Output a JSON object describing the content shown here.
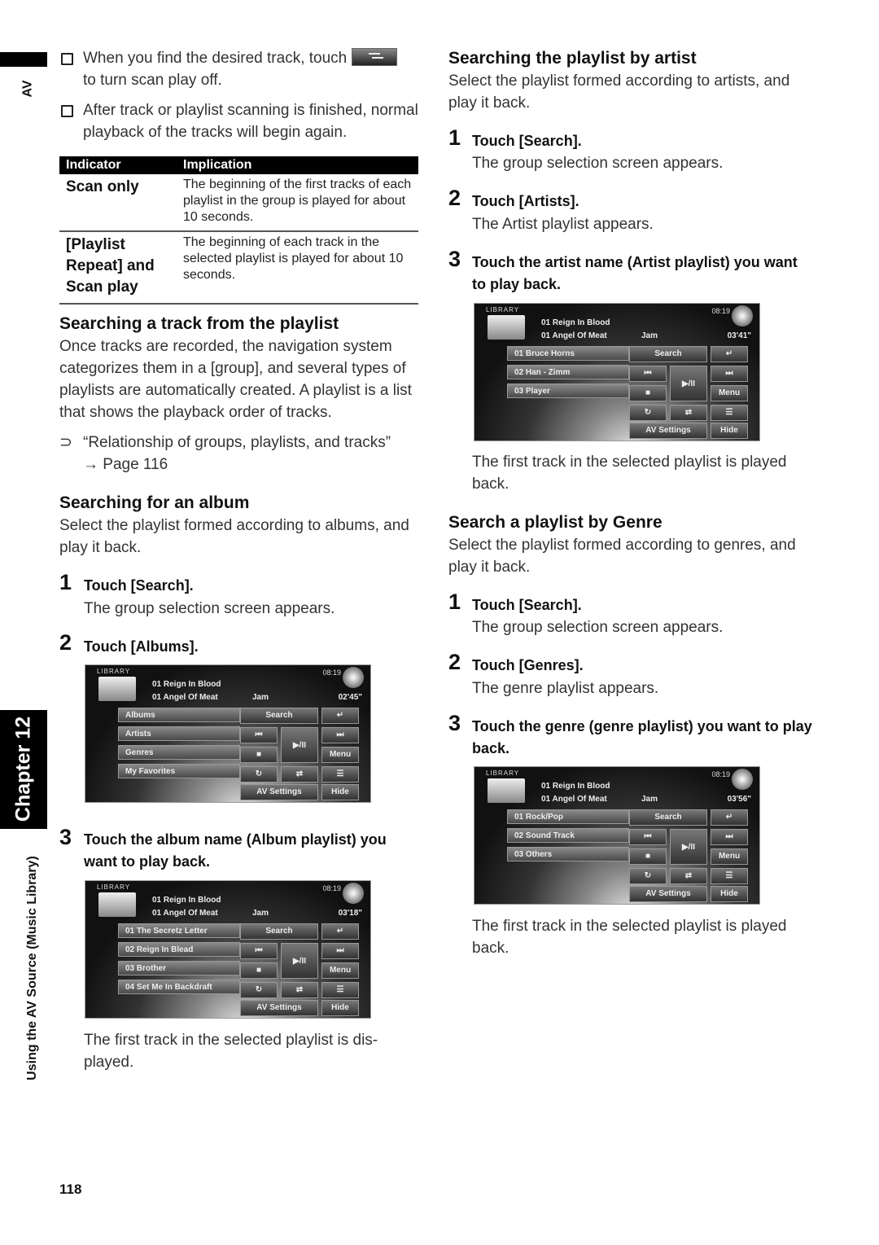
{
  "side": {
    "section_tab": "AV",
    "chapter_label": "Chapter 12",
    "chapter_title": "Using the AV Source (Music Library)"
  },
  "page_number": "118",
  "left": {
    "notes": [
      {
        "before": "When you find the desired track, touch",
        "icon": "scan-button-icon",
        "after": "to turn scan play off."
      },
      {
        "text": "After track or playlist scanning is finished, normal playback of the tracks will begin again."
      }
    ],
    "table": {
      "headers": [
        "Indicator",
        "Implication"
      ],
      "rows": [
        {
          "indicator": "Scan only",
          "implication": "The beginning of the first tracks of each playlist in the group is played for about 10 seconds."
        },
        {
          "indicator": "[Playlist Repeat] and Scan play",
          "implication": "The beginning of each track in the selected playlist is played for about 10 seconds."
        }
      ]
    },
    "section_track": {
      "heading": "Searching a track from the playlist",
      "body": "Once tracks are recorded, the navigation system categorizes them in a [group], and several types of playlists are automatically created. A playlist is a list that shows the playback order of tracks.",
      "ref_text": "“Relationship of groups, playlists, and tracks”",
      "ref_page": "→ Page 116"
    },
    "section_album": {
      "heading": "Searching for an album",
      "body": "Select the playlist formed according to albums, and play it back.",
      "steps": [
        {
          "num": "1",
          "title": "Touch [Search].",
          "desc": "The group selection screen appears."
        },
        {
          "num": "2",
          "title": "Touch [Albums].",
          "desc": ""
        },
        {
          "num": "3",
          "title": "Touch the album name (Album playlist) you want to play back.",
          "desc": ""
        }
      ],
      "caption": "The first track in the selected playlist is dis- played."
    }
  },
  "right": {
    "section_artist": {
      "heading": "Searching the playlist by artist",
      "body": "Select the playlist formed according to artists, and play it back.",
      "steps": [
        {
          "num": "1",
          "title": "Touch [Search].",
          "desc": "The group selection screen appears."
        },
        {
          "num": "2",
          "title": "Touch [Artists].",
          "desc": "The Artist playlist appears."
        },
        {
          "num": "3",
          "title": "Touch the artist name (Artist playlist) you want to play back.",
          "desc": ""
        }
      ],
      "caption": "The first track in the selected playlist is played back."
    },
    "section_genre": {
      "heading": "Search a playlist by Genre",
      "body": "Select the playlist formed according to genres, and play it back.",
      "steps": [
        {
          "num": "1",
          "title": "Touch [Search].",
          "desc": "The group selection screen appears."
        },
        {
          "num": "2",
          "title": "Touch [Genres].",
          "desc": "The genre playlist appears."
        },
        {
          "num": "3",
          "title": "Touch the genre (genre playlist) you want to play back.",
          "desc": ""
        }
      ],
      "caption": "The first track in the selected playlist is played back."
    }
  },
  "screens": {
    "common": {
      "library": "LIBRARY",
      "clock": "08:19",
      "track1": "01  Reign In Blood",
      "track2": "01  Angel Of Meat",
      "genre": "Jam",
      "search": "Search",
      "menu": "Menu",
      "av_settings": "AV Settings",
      "hide": "Hide",
      "prev": "⏮",
      "next": "⏭",
      "playpause": "▶/II"
    },
    "groups": {
      "time": "02'45\"",
      "items": [
        "Albums",
        "Artists",
        "Genres",
        "My Favorites"
      ]
    },
    "albums": {
      "time": "03'18\"",
      "items": [
        "01 The Secretz Letter",
        "02 Reign In Blead",
        "03 Brother",
        "04 Set Me In Backdraft"
      ]
    },
    "artists": {
      "time": "03'41\"",
      "items": [
        "01 Bruce Horns",
        "02 Han - Zimm",
        "03 Player"
      ]
    },
    "genres": {
      "time": "03'56\"",
      "items": [
        "01 Rock/Pop",
        "02 Sound Track",
        "03 Others"
      ]
    }
  }
}
